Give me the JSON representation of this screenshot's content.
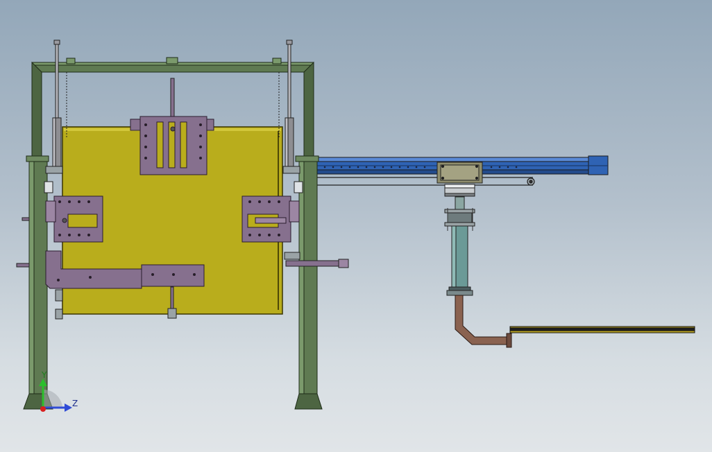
{
  "viewport": {
    "background_top": "#93a7b9",
    "background_bottom": "#e1e5e8"
  },
  "colors": {
    "frame": "#5f7a52",
    "panel": "#b9ad1c",
    "plate": "#86708e",
    "rail": "#2f63b4",
    "column": "#6b9a97",
    "pipe": "#8a6250",
    "cylinder": "#8e8e92",
    "carriage": "#8f8d6c"
  },
  "triad": {
    "y_label": "Y",
    "z_label": "Z",
    "y_color": "#2bbf2b",
    "z_color": "#2f4bd6",
    "x_color": "#d82020"
  }
}
